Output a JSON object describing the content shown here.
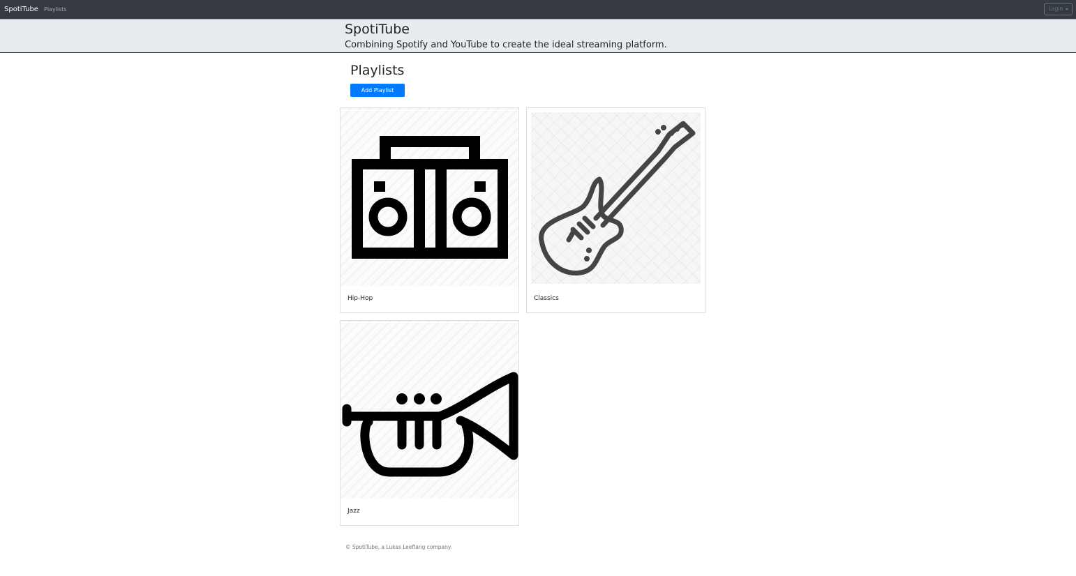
{
  "navbar": {
    "brand": "SpotiTube",
    "links": [
      "Playlists"
    ],
    "login_label": "Login"
  },
  "jumbotron": {
    "title": "SpotiTube",
    "subtitle": "Combining Spotify and YouTube to create the ideal streaming platform."
  },
  "main": {
    "title": "Playlists",
    "add_button_label": "Add Playlist",
    "playlists": [
      {
        "name": "Hip-Hop",
        "icon": "boombox-icon"
      },
      {
        "name": "Classics",
        "icon": "guitar-icon"
      },
      {
        "name": "Jazz",
        "icon": "trumpet-icon"
      }
    ]
  },
  "footer": {
    "text": "© SpotiTube, a Lukas Leeflang company."
  },
  "colors": {
    "navbar": "#343a40",
    "jumbotron": "#e9ecef",
    "primary": "#007bff"
  }
}
